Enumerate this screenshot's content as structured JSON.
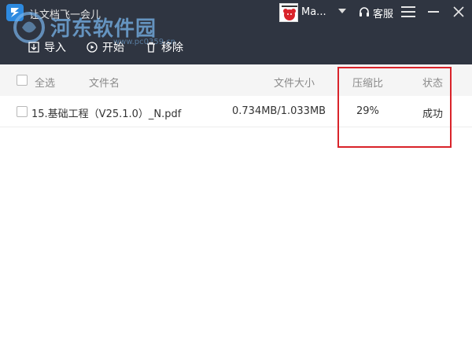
{
  "window": {
    "title": "让文档飞一会儿",
    "watermark_text": "河东软件园",
    "watermark_url": "www.pc0359.cn"
  },
  "user": {
    "name": "Ma...",
    "avatar_icon": "user-avatar-icon"
  },
  "titlebar": {
    "service_label": "客服"
  },
  "toolbar": {
    "import_label": "导入",
    "start_label": "开始",
    "remove_label": "移除"
  },
  "table": {
    "columns": {
      "select_all": "全选",
      "filename": "文件名",
      "filesize": "文件大小",
      "ratio": "压缩比",
      "status": "状态"
    },
    "rows": [
      {
        "filename": "15.基础工程（V25.1.0）_N.pdf",
        "filesize": "0.734MB/1.033MB",
        "ratio": "29%",
        "status": "成功"
      }
    ]
  },
  "colors": {
    "header_bg": "#2f3541",
    "table_header_bg": "#f5f5f5",
    "highlight": "#d9232a",
    "accent": "#2d8ae0"
  }
}
